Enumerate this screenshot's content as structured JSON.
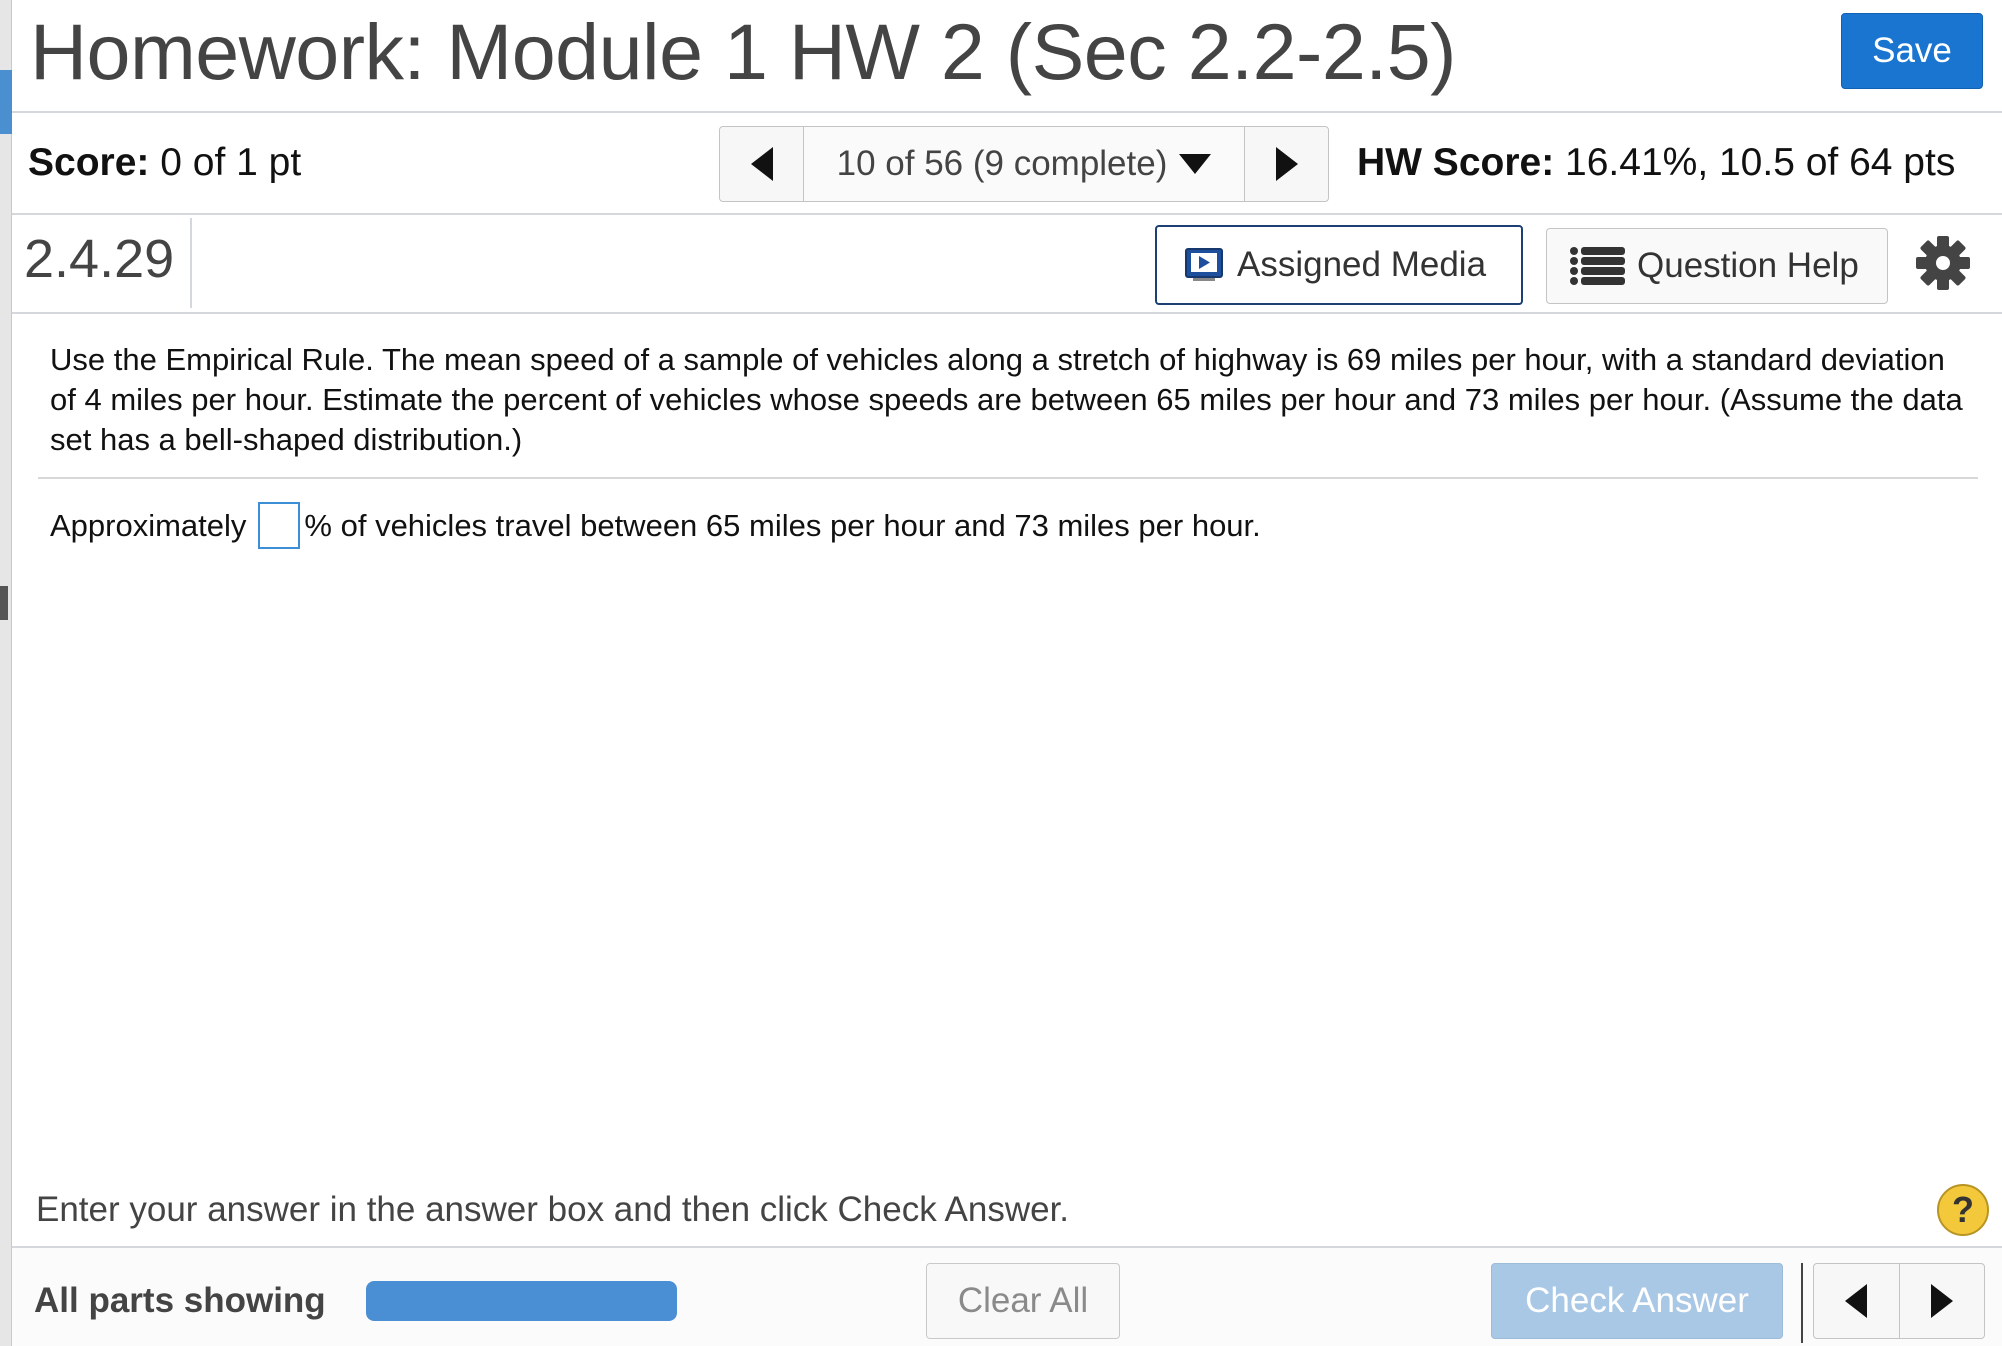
{
  "header": {
    "title": "Homework: Module 1 HW 2 (Sec 2.2-2.5)",
    "save_label": "Save"
  },
  "score_bar": {
    "score_label": "Score:",
    "score_value": "0 of 1 pt",
    "nav_label": "10 of 56 (9 complete)",
    "hw_score_label": "HW Score:",
    "hw_score_value": "16.41%, 10.5 of 64 pts"
  },
  "question_bar": {
    "number": "2.4.29",
    "assigned_media_label": "Assigned Media",
    "question_help_label": "Question Help"
  },
  "question": {
    "text": "Use the Empirical Rule. The mean speed of a sample of vehicles along a stretch of highway is 69 miles per hour, with a standard deviation of 4 miles per hour. Estimate the percent of vehicles whose speeds are between 65 miles per hour and 73 miles per hour. (Assume the data set has a bell-shaped distribution.)",
    "answer_prefix": "Approximately",
    "answer_value": "",
    "answer_suffix": "% of vehicles travel between 65 miles per hour and 73 miles per hour."
  },
  "footer": {
    "instructions": "Enter your answer in the answer box and then click Check Answer.",
    "help_glyph": "?",
    "parts_label": "All parts showing",
    "progress_fraction": 1.0,
    "clear_label": "Clear All",
    "check_label": "Check Answer"
  },
  "colors": {
    "accent": "#1a75d1",
    "check_disabled": "#a9c8e6",
    "progress": "#4a8fd4",
    "help_badge": "#f3c93b"
  },
  "icons": {
    "prev": "triangle-left",
    "next": "triangle-right",
    "dropdown": "triangle-down",
    "media": "video-player-icon",
    "help": "list-icon",
    "settings": "gear-icon"
  }
}
